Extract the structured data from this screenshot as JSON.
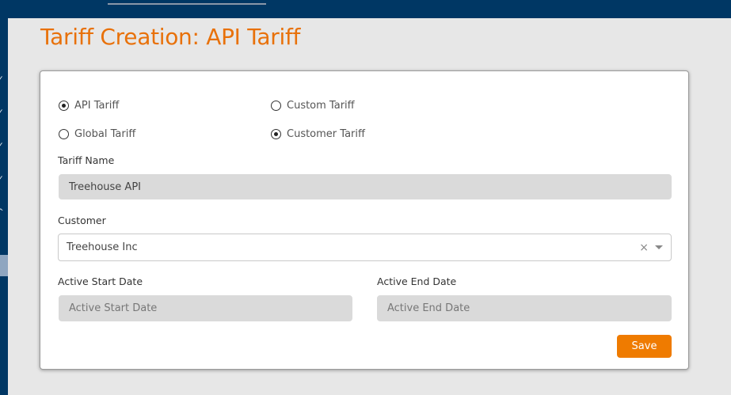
{
  "page": {
    "title": "Tariff Creation: API Tariff"
  },
  "form": {
    "radios": {
      "api_tariff": {
        "label": "API Tariff",
        "checked": true
      },
      "custom_tariff": {
        "label": "Custom Tariff",
        "checked": false
      },
      "global_tariff": {
        "label": "Global Tariff",
        "checked": false
      },
      "customer_tariff": {
        "label": "Customer Tariff",
        "checked": true
      }
    },
    "tariff_name": {
      "label": "Tariff Name",
      "value": "Treehouse API"
    },
    "customer": {
      "label": "Customer",
      "value": "Treehouse Inc"
    },
    "active_start": {
      "label": "Active Start Date",
      "placeholder": "Active Start Date"
    },
    "active_end": {
      "label": "Active End Date",
      "placeholder": "Active End Date"
    },
    "save_label": "Save"
  },
  "colors": {
    "accent": "#e8710a",
    "nav": "#003764",
    "button": "#ef7b00"
  }
}
